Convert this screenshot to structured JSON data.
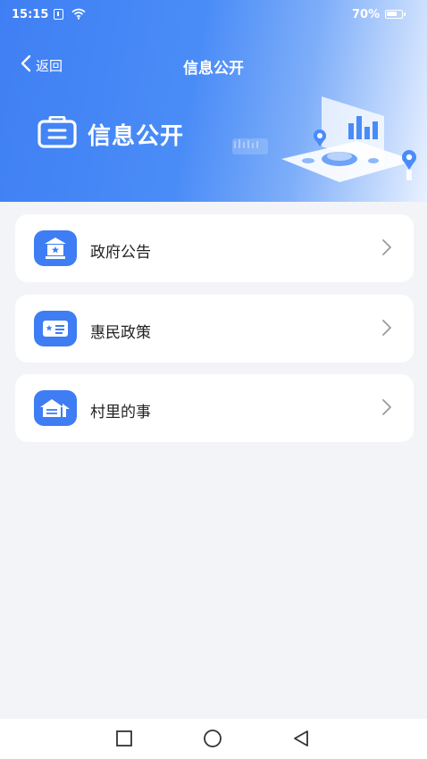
{
  "status_bar": {
    "time": "15:15",
    "battery_percent": "70%"
  },
  "header": {
    "back_label": "返回",
    "title": "信息公开"
  },
  "hero": {
    "title": "信息公开"
  },
  "menu": {
    "items": [
      {
        "label": "政府公告",
        "icon": "government-building-icon"
      },
      {
        "label": "惠民政策",
        "icon": "policy-card-icon"
      },
      {
        "label": "村里的事",
        "icon": "village-house-icon"
      }
    ]
  },
  "system_nav": {
    "buttons": [
      "recent-apps",
      "home",
      "back"
    ]
  },
  "colors": {
    "accent": "#3e7df4",
    "background": "#f3f4f8",
    "card": "#ffffff",
    "text": "#222222",
    "chevron": "#9a9a9a"
  }
}
